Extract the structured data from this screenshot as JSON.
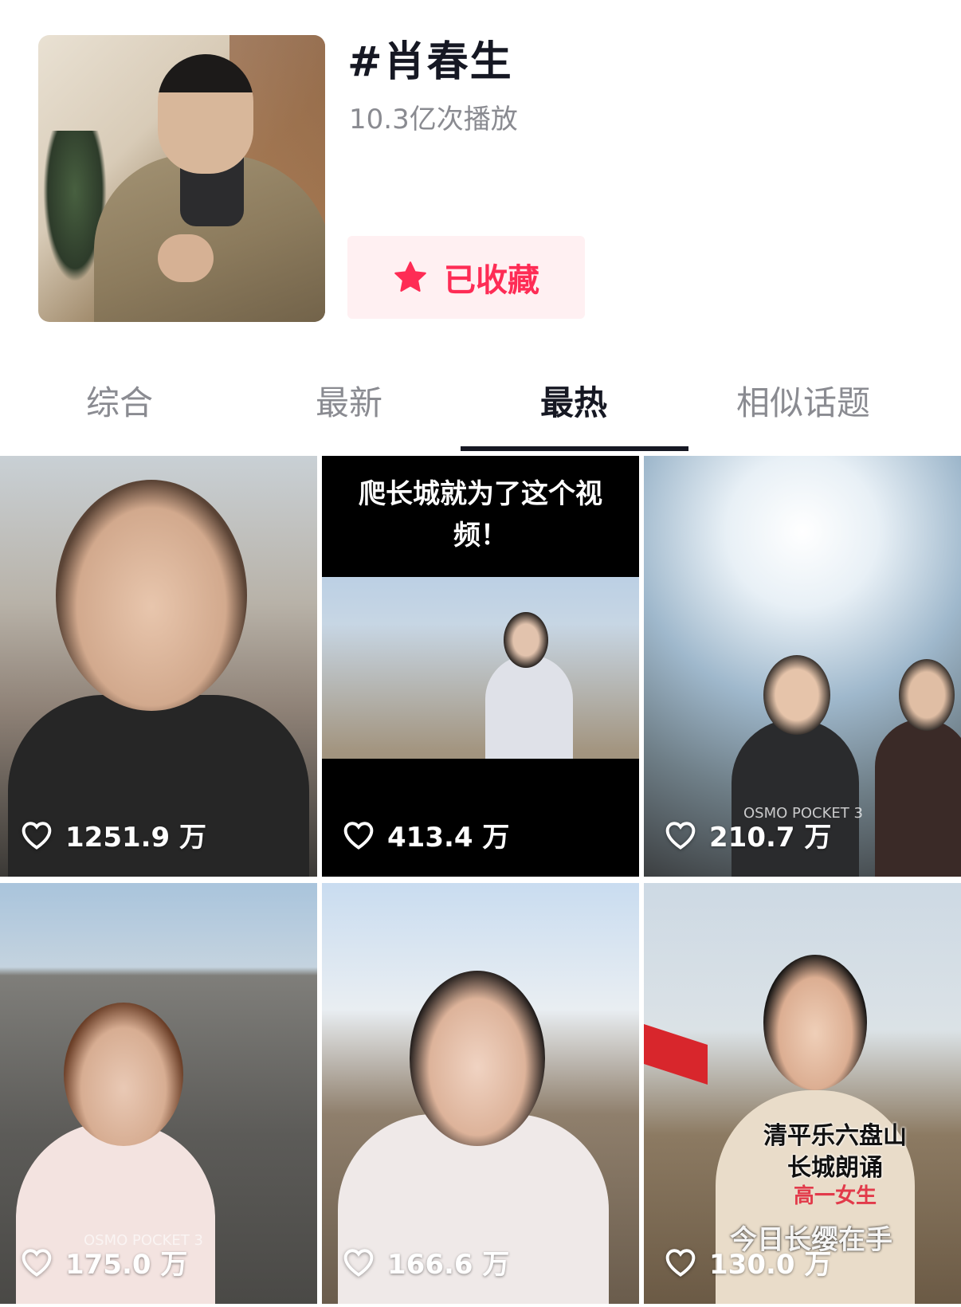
{
  "topic": {
    "title": "#肖春生",
    "play_count": "10.3亿次播放",
    "favorite_label": "已收藏"
  },
  "tabs": [
    {
      "label": "综合",
      "active": false
    },
    {
      "label": "最新",
      "active": false
    },
    {
      "label": "最热",
      "active": true
    },
    {
      "label": "相似话题",
      "active": false
    }
  ],
  "videos": [
    {
      "likes": "1251.9 万"
    },
    {
      "likes": "413.4 万",
      "caption": "爬长城就为了这个视频！"
    },
    {
      "likes": "210.7 万",
      "watermark": "OSMO POCKET 3"
    },
    {
      "likes": "175.0 万",
      "watermark": "OSMO POCKET 3"
    },
    {
      "likes": "166.6 万"
    },
    {
      "likes": "130.0 万",
      "overlay_line1": "清平乐六盘山",
      "overlay_line2": "长城朗诵",
      "overlay_line3": "高一女生",
      "overlay_line4": "今日长缨在手"
    }
  ],
  "colors": {
    "accent": "#fe2c55",
    "fav_bg": "#fff0f2",
    "text_primary": "#161823",
    "text_secondary": "#8a8b91"
  }
}
